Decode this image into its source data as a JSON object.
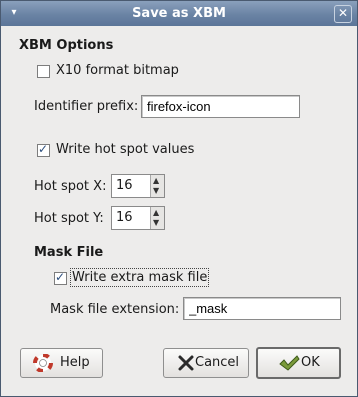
{
  "window": {
    "title": "Save as XBM"
  },
  "titlebar": {
    "menu_glyph": "▾",
    "close_glyph": "✕"
  },
  "xbm_options": {
    "heading": "XBM Options",
    "x10_label": "X10 format bitmap",
    "identifier_label": "Identifier prefix:",
    "identifier_value": "firefox-icon",
    "hotspot_label": "Write hot spot values",
    "hotspot_x_label": "Hot spot X:",
    "hotspot_x_value": "16",
    "hotspot_y_label": "Hot spot Y:",
    "hotspot_y_value": "16"
  },
  "mask_file": {
    "heading": "Mask File",
    "write_mask_label": "Write extra mask file",
    "extension_label": "Mask file extension:",
    "extension_value": "_mask"
  },
  "buttons": {
    "help": "Help",
    "cancel": "Cancel",
    "ok": "OK"
  },
  "checkbox_states": {
    "x10": false,
    "hotspot": true,
    "mask": true
  }
}
